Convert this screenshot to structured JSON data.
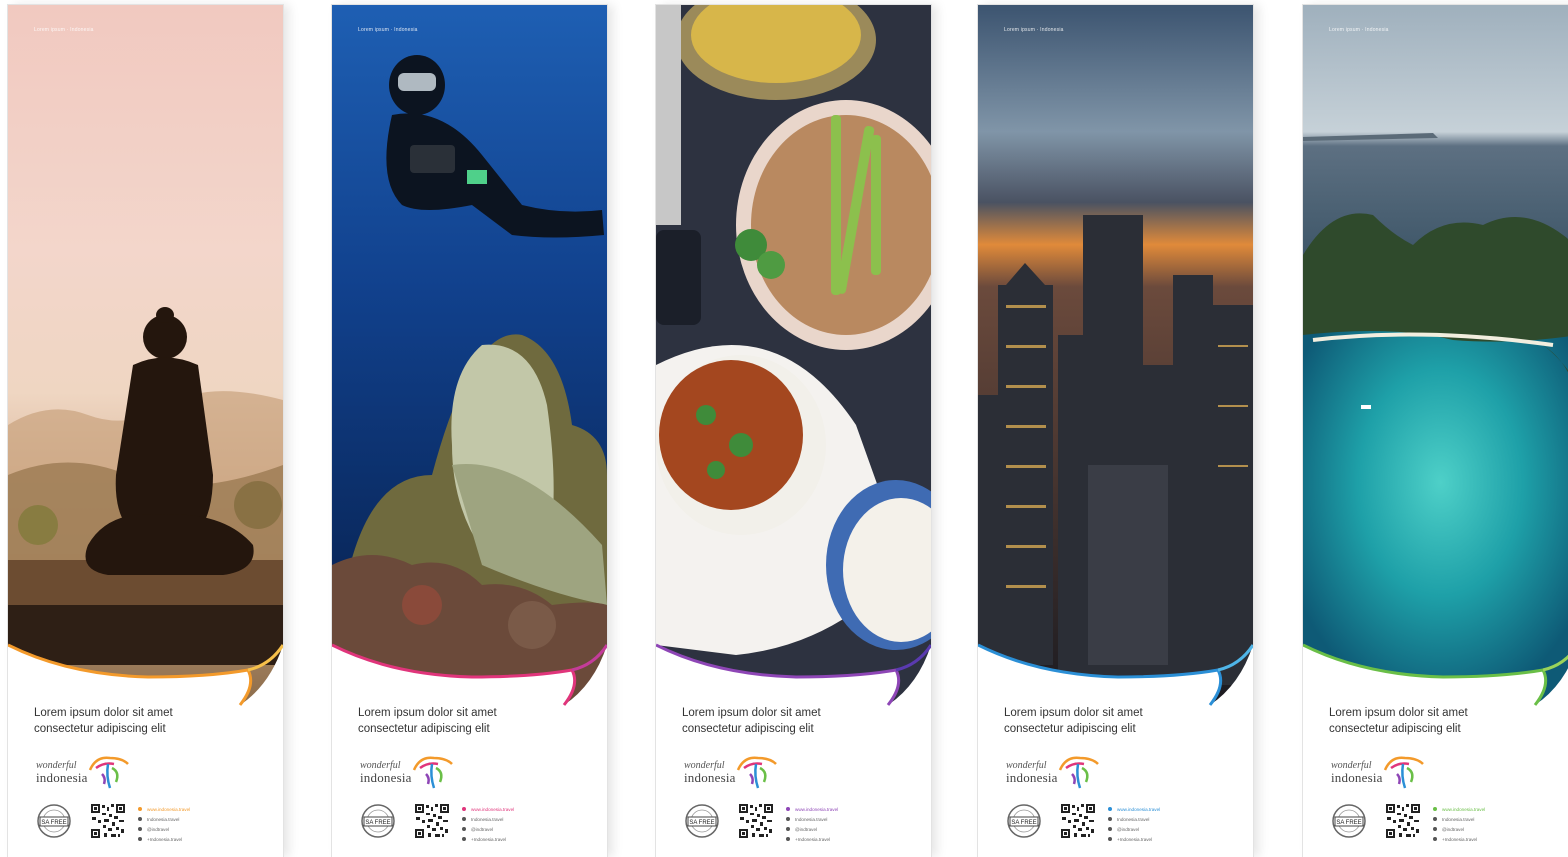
{
  "tiny_title": "Lorem ipsum · Indonesia",
  "banners": [
    {
      "theme": "yoga",
      "accent": "#f39a2b",
      "headline_line1": "Lorem ipsum dolor sit amet",
      "headline_line2": "consectetur adipiscing elit"
    },
    {
      "theme": "diver",
      "accent": "#e0357b",
      "headline_line1": "Lorem ipsum dolor sit amet",
      "headline_line2": "consectetur adipiscing elit"
    },
    {
      "theme": "food",
      "accent": "#8e46b6",
      "headline_line1": "Lorem ipsum dolor sit amet",
      "headline_line2": "consectetur adipiscing elit"
    },
    {
      "theme": "city",
      "accent": "#2b8fd6",
      "headline_line1": "Lorem ipsum dolor sit amet",
      "headline_line2": "consectetur adipiscing elit"
    },
    {
      "theme": "island",
      "accent": "#6abf47",
      "headline_line1": "Lorem ipsum dolor sit amet",
      "headline_line2": "consectetur adipiscing elit"
    }
  ],
  "logo": {
    "line1": "wonderful",
    "line2": "indonesia"
  },
  "badge": {
    "label": "SA FREE"
  },
  "social": [
    {
      "icon": "globe-icon",
      "text": "www.indonesia.travel"
    },
    {
      "icon": "facebook-icon",
      "text": "Indonesia.travel"
    },
    {
      "icon": "twitter-icon",
      "text": "@indtravel"
    },
    {
      "icon": "google-plus-icon",
      "text": "+Indonesia.travel"
    }
  ]
}
